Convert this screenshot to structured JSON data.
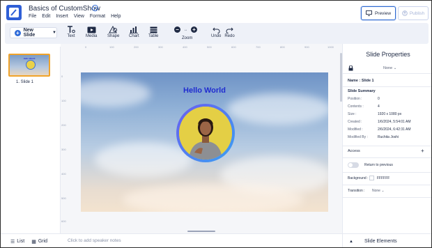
{
  "app": {
    "title": "Basics of CustomShow",
    "menu": [
      "File",
      "Edit",
      "Insert",
      "View",
      "Format",
      "Help"
    ],
    "preview_label": "Preview",
    "publish_label": "Publish"
  },
  "toolbar": {
    "new_slide_label": "New Slide",
    "tools": [
      "Text",
      "Media",
      "Shape",
      "Chart",
      "Table"
    ],
    "zoom_label": "Zoom",
    "undo_label": "Undo",
    "redo_label": "Redo"
  },
  "ruler": {
    "top": [
      "0",
      "100",
      "200",
      "300",
      "400",
      "500",
      "600",
      "700",
      "800",
      "900",
      "1000"
    ],
    "left": [
      "0",
      "100",
      "200",
      "300",
      "400",
      "500",
      "600"
    ]
  },
  "slides": [
    {
      "label": "1. Slide 1"
    }
  ],
  "canvas": {
    "slide_title": "Hello World",
    "notes_placeholder": "Click to add speaker notes"
  },
  "bottom_tabs": [
    "List",
    "Grid"
  ],
  "properties": {
    "panel_title": "Slide Properties",
    "lock_value": "None",
    "name_label": "Name : Slide 1",
    "summary_title": "Slide Summary",
    "summary": [
      {
        "key": "Position :",
        "value": "0"
      },
      {
        "key": "Contents :",
        "value": "4"
      },
      {
        "key": "Size :",
        "value": "1920 x 1080 px"
      },
      {
        "key": "Created :",
        "value": "1/6/2024, 5:54:01 AM"
      },
      {
        "key": "Modified :",
        "value": "2/6/2024, 6:42:31 AM"
      },
      {
        "key": "Modified By :",
        "value": "Ruchita Joshi"
      }
    ],
    "access_label": "Access",
    "access_add": "+",
    "return_label": "Return to previous",
    "background_label": "Background :",
    "background_value": "FFFFFF",
    "transition_label": "Transition :",
    "transition_value": "None",
    "elements_label": "Slide Elements"
  },
  "colors": {
    "accent": "#2f6bd8",
    "title_blue": "#1f2bd0",
    "highlight_orange": "#f0a32a"
  }
}
